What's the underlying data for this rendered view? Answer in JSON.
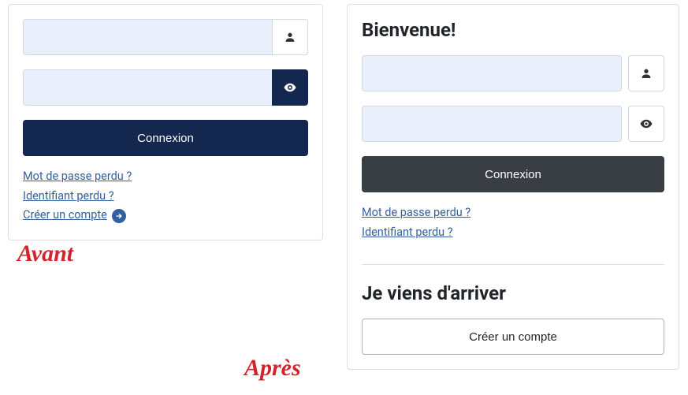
{
  "left": {
    "username_value": "",
    "password_value": "",
    "login_label": "Connexion",
    "forgot_password": "Mot de passe perdu ?",
    "forgot_username": "Identifiant perdu ?",
    "create_account": "Créer un compte"
  },
  "right": {
    "welcome_heading": "Bienvenue!",
    "username_value": "",
    "password_value": "",
    "login_label": "Connexion",
    "forgot_password": "Mot de passe perdu ?",
    "forgot_username": "Identifiant perdu ?",
    "newcomer_heading": "Je viens d'arriver",
    "create_account": "Créer un compte"
  },
  "annotations": {
    "before": "Avant",
    "after": "Après"
  }
}
